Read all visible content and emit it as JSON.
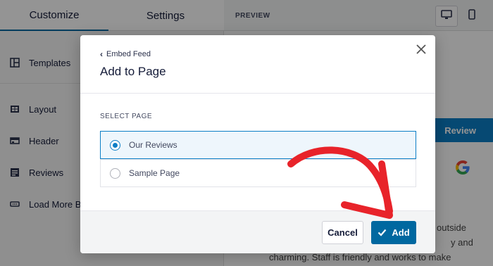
{
  "sidebar": {
    "tabs": [
      {
        "label": "Customize"
      },
      {
        "label": "Settings"
      }
    ],
    "items": [
      {
        "label": "Templates",
        "icon": "templates-icon"
      },
      {
        "label": "Layout",
        "icon": "layout-icon"
      },
      {
        "label": "Header",
        "icon": "header-icon"
      },
      {
        "label": "Reviews",
        "icon": "reviews-icon"
      },
      {
        "label": "Load More Bu",
        "icon": "load-more-icon"
      }
    ]
  },
  "preview": {
    "label": "PREVIEW",
    "review_button": "Review",
    "google_glyph": "G",
    "text_lines": [
      "outside",
      "y and",
      "charming. Staff is friendly and works to make"
    ]
  },
  "modal": {
    "back_label": "Embed Feed",
    "title": "Add to Page",
    "select_label": "SELECT PAGE",
    "options": [
      {
        "label": "Our Reviews",
        "selected": true
      },
      {
        "label": "Sample Page",
        "selected": false
      }
    ],
    "cancel_label": "Cancel",
    "add_label": "Add"
  },
  "colors": {
    "accent": "#0068a0",
    "selected_border": "#0b7ec6",
    "arrow": "#e8232a"
  }
}
